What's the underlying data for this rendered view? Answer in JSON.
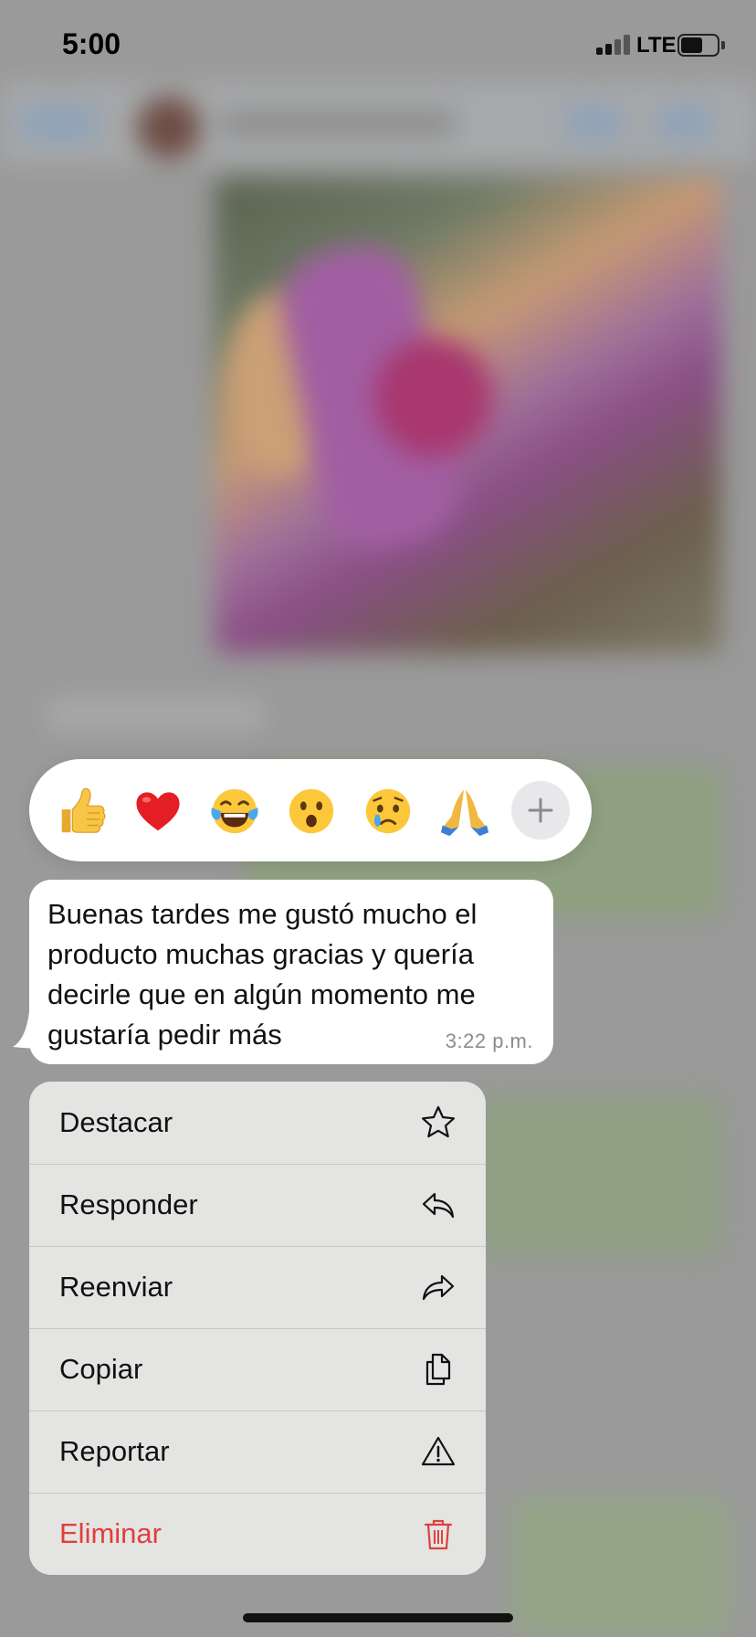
{
  "status_bar": {
    "time": "5:00",
    "network": "LTE"
  },
  "reactions": {
    "items": [
      {
        "name": "thumbs-up"
      },
      {
        "name": "red-heart"
      },
      {
        "name": "face-with-tears-of-joy"
      },
      {
        "name": "face-with-open-mouth"
      },
      {
        "name": "crying-face"
      },
      {
        "name": "folded-hands"
      }
    ],
    "more_icon": "plus-icon"
  },
  "message": {
    "text": "Buenas tardes me gustó mucho el producto muchas gracias y quería decirle que en algún momento me gustaría pedir más",
    "time": "3:22 p.m."
  },
  "menu": {
    "items": [
      {
        "label": "Destacar",
        "icon": "star-icon"
      },
      {
        "label": "Responder",
        "icon": "reply-icon"
      },
      {
        "label": "Reenviar",
        "icon": "forward-icon"
      },
      {
        "label": "Copiar",
        "icon": "copy-icon"
      },
      {
        "label": "Reportar",
        "icon": "warning-icon"
      },
      {
        "label": "Eliminar",
        "icon": "trash-icon",
        "destructive": true
      }
    ]
  },
  "colors": {
    "overlay_bg": "#9a9a9a",
    "bubble_bg": "#ffffff",
    "menu_bg": "#e4e4e3",
    "destructive": "#e0403a",
    "timestamp": "#8c8c8c"
  }
}
